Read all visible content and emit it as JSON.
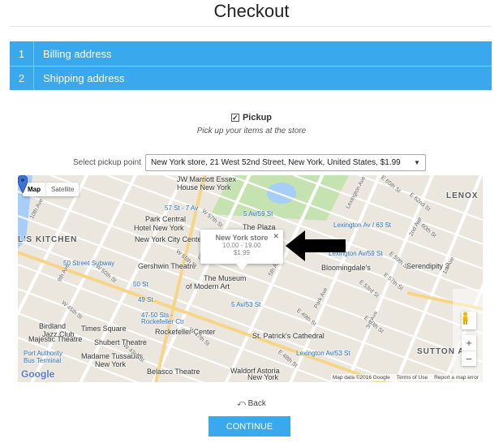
{
  "page": {
    "title": "Checkout"
  },
  "steps": [
    {
      "number": "1",
      "label": "Billing address"
    },
    {
      "number": "2",
      "label": "Shipping address"
    }
  ],
  "pickup": {
    "checked": true,
    "label": "Pickup",
    "description": "Pick up your items at the store"
  },
  "pickup_point": {
    "label": "Select pickup point",
    "selected": "New York store, 21 West 52nd Street, New York, United States, $1.99"
  },
  "map": {
    "type_controls": [
      "Map",
      "Satellite"
    ],
    "labels": {
      "hells_kitchen": "L'S KITCHEN",
      "lenox": "LENOX",
      "sutton": "SUTTON A",
      "jw_marriott": "JW Marriott Essex",
      "jw_marriott_2": "House New York",
      "park_central": "Park Central",
      "park_central_2": "Hotel New York",
      "ny_city_center": "New York City Center",
      "gershwin": "Gershwin Theatre",
      "moma": "The Museum",
      "moma_2": "of Modern Art",
      "times_square": "Times Square",
      "rockefeller": "Rockefeller Center",
      "st_patricks": "St. Patrick's Cathedral",
      "birdland": "Birdland",
      "birdland_2": "Jazz Club",
      "majestic": "Majestic Theatre",
      "shubert": "Shubert Theatre",
      "tussauds": "Madame Tussauds",
      "tussauds_2": "New York",
      "belasco": "Belasco Theatre",
      "waldorf": "Waldorf Astoria",
      "waldorf_2": "New York",
      "bloomingdales": "Bloomingdale's",
      "serendipity": "Serendipity 3",
      "plaza": "The Plaza",
      "st_7av": "57 St - 7 Av",
      "st_5av59": "5 Av/59 St",
      "st_lex": "Lexington Av / 63 St",
      "st_lex59": "Lexington Av/59 St",
      "st_50sub": "50 Street Subway",
      "st_50": "50 St",
      "st_49": "49 St",
      "st_4750": "47-50 Sts -",
      "st_4750_2": "Rockefeller Ctr",
      "st_5av53": "5 Av/53 St",
      "st_lex53": "Lexington Av/53 St",
      "port_auth": "Port Authority",
      "port_auth_2": "Bus Terminal",
      "w57": "W 57th St",
      "w55": "W 55th St",
      "w50": "W 50th St",
      "w47": "W 47th St",
      "w45": "W 45th St",
      "w43": "W 43rd St",
      "e60": "E 60th St",
      "e57": "E 57th St",
      "e59": "E 59th St",
      "e53": "E 53rd St",
      "e50": "E 50th St",
      "e49": "E 49th St",
      "e48": "E 48th St",
      "e62": "E 62nd St",
      "e65": "E 65th St",
      "av5": "5th Ave",
      "av6": "6th Ave",
      "av9": "9th Ave",
      "av10": "10th Ave",
      "av3": "3rd Ave",
      "av1": "1st Ave",
      "av2": "2nd Ave",
      "park": "Park Ave",
      "lex": "Lexington Ave"
    },
    "info_window": {
      "name": "New York store",
      "hours": "10.00 - 19.00",
      "price": "$1.99"
    },
    "zoom_in": "+",
    "zoom_out": "−",
    "logo": "Google",
    "footer": [
      "Map data ©2016 Google",
      "Terms of Use",
      "Report a map error"
    ]
  },
  "actions": {
    "back": "Back",
    "continue": "CONTINUE"
  },
  "colors": {
    "accent": "#3aa8ec",
    "park": "#c5e3b0",
    "water": "#a6cef7",
    "road": "#ffffff",
    "block": "#ebe7df",
    "highlight_road": "#f6d589"
  }
}
